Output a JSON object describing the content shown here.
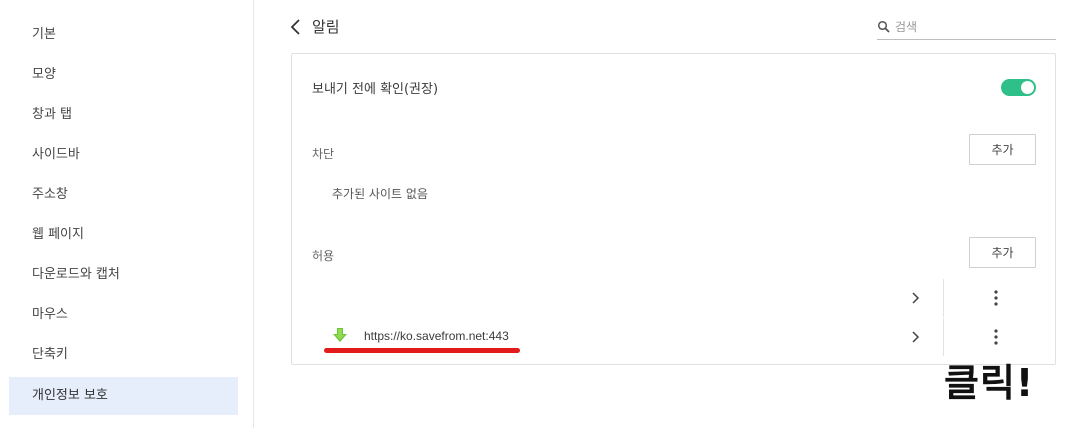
{
  "sidebar": {
    "items": [
      {
        "label": "기본",
        "active": false
      },
      {
        "label": "모양",
        "active": false
      },
      {
        "label": "창과 탭",
        "active": false
      },
      {
        "label": "사이드바",
        "active": false
      },
      {
        "label": "주소창",
        "active": false
      },
      {
        "label": "웹 페이지",
        "active": false
      },
      {
        "label": "다운로드와 캡처",
        "active": false
      },
      {
        "label": "마우스",
        "active": false
      },
      {
        "label": "단축키",
        "active": false
      },
      {
        "label": "개인정보 보호",
        "active": true
      }
    ]
  },
  "header": {
    "title": "알림",
    "search_placeholder": "검색"
  },
  "settings": {
    "confirm_label": "보내기 전에 확인(권장)",
    "confirm_enabled": true,
    "block_label": "차단",
    "block_add": "추가",
    "block_empty": "추가된 사이트 없음",
    "allow_label": "허용",
    "allow_add": "추가",
    "allow_sites": [
      {
        "url": "",
        "icon": "none"
      },
      {
        "url": "https://ko.savefrom.net:443",
        "icon": "green-download-arrow-icon"
      }
    ]
  },
  "annotation": {
    "text": "클릭!",
    "underline_color": "#e21c1c"
  },
  "colors": {
    "toggle_on": "#2fbf88",
    "sidebar_active": "#e5eefa"
  }
}
